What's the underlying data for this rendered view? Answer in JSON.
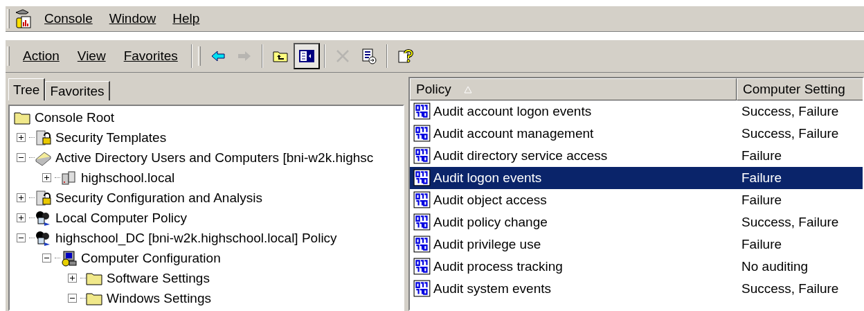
{
  "menu_bar": {
    "items": [
      "Console",
      "Window",
      "Help"
    ]
  },
  "toolbar": {
    "menus": [
      "Action",
      "View",
      "Favorites"
    ],
    "tools": [
      {
        "kind": "back",
        "disabled": false,
        "pressed": false
      },
      {
        "kind": "forward",
        "disabled": true,
        "pressed": false
      },
      {
        "kind": "up",
        "disabled": false,
        "pressed": false
      },
      {
        "kind": "tree-toggle",
        "disabled": false,
        "pressed": true
      },
      {
        "kind": "delete",
        "disabled": true,
        "pressed": false
      },
      {
        "kind": "export",
        "disabled": false,
        "pressed": false
      },
      {
        "kind": "help",
        "disabled": false,
        "pressed": false
      }
    ]
  },
  "left_tabs": [
    {
      "label": "Tree",
      "selected": true
    },
    {
      "label": "Favorites",
      "selected": false
    }
  ],
  "tree": {
    "root": {
      "label": "Console Root",
      "kind": "folder"
    },
    "children": [
      {
        "label": "Security Templates",
        "kind": "snapin",
        "expanded": false
      },
      {
        "label": "Active Directory Users and Computers [bni-w2k.highsc",
        "kind": "directory",
        "expanded": true,
        "children": [
          {
            "label": "highschool.local",
            "kind": "domain",
            "expanded": false
          }
        ]
      },
      {
        "label": "Security Configuration and Analysis",
        "kind": "snapin",
        "expanded": false
      },
      {
        "label": "Local Computer Policy",
        "kind": "policy",
        "expanded": false
      },
      {
        "label": "highschool_DC [bni-w2k.highschool.local] Policy",
        "kind": "policy",
        "expanded": true,
        "children": [
          {
            "label": "Computer Configuration",
            "kind": "computer",
            "expanded": true,
            "children": [
              {
                "label": "Software Settings",
                "kind": "folder",
                "expanded": false
              },
              {
                "label": "Windows Settings",
                "kind": "folder",
                "expanded": true
              }
            ]
          }
        ]
      }
    ]
  },
  "list": {
    "columns": [
      {
        "label": "Policy",
        "sorted": true
      },
      {
        "label": "Computer Setting",
        "sorted": false
      }
    ],
    "rows": [
      {
        "policy": "Audit account logon events",
        "setting": "Success, Failure",
        "selected": false
      },
      {
        "policy": "Audit account management",
        "setting": "Success, Failure",
        "selected": false
      },
      {
        "policy": "Audit directory service access",
        "setting": "Failure",
        "selected": false
      },
      {
        "policy": "Audit logon events",
        "setting": "Failure",
        "selected": true
      },
      {
        "policy": "Audit object access",
        "setting": "Failure",
        "selected": false
      },
      {
        "policy": "Audit policy change",
        "setting": "Success, Failure",
        "selected": false
      },
      {
        "policy": "Audit privilege use",
        "setting": "Failure",
        "selected": false
      },
      {
        "policy": "Audit process tracking",
        "setting": "No auditing",
        "selected": false
      },
      {
        "policy": "Audit system events",
        "setting": "Success, Failure",
        "selected": false
      }
    ]
  }
}
